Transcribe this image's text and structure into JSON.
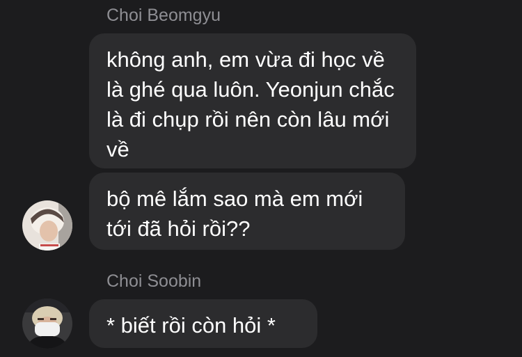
{
  "messages": [
    {
      "sender": "Choi Beomgyu",
      "bubbles": [
        "không anh, em vừa đi học về là ghé qua luôn. Yeonjun chắc là đi chụp rồi nên còn lâu mới về",
        "bộ mê lắm sao mà em mới tới đã hỏi rồi??"
      ]
    },
    {
      "sender": "Choi Soobin",
      "bubbles": [
        "* biết rồi còn hỏi *"
      ]
    }
  ]
}
